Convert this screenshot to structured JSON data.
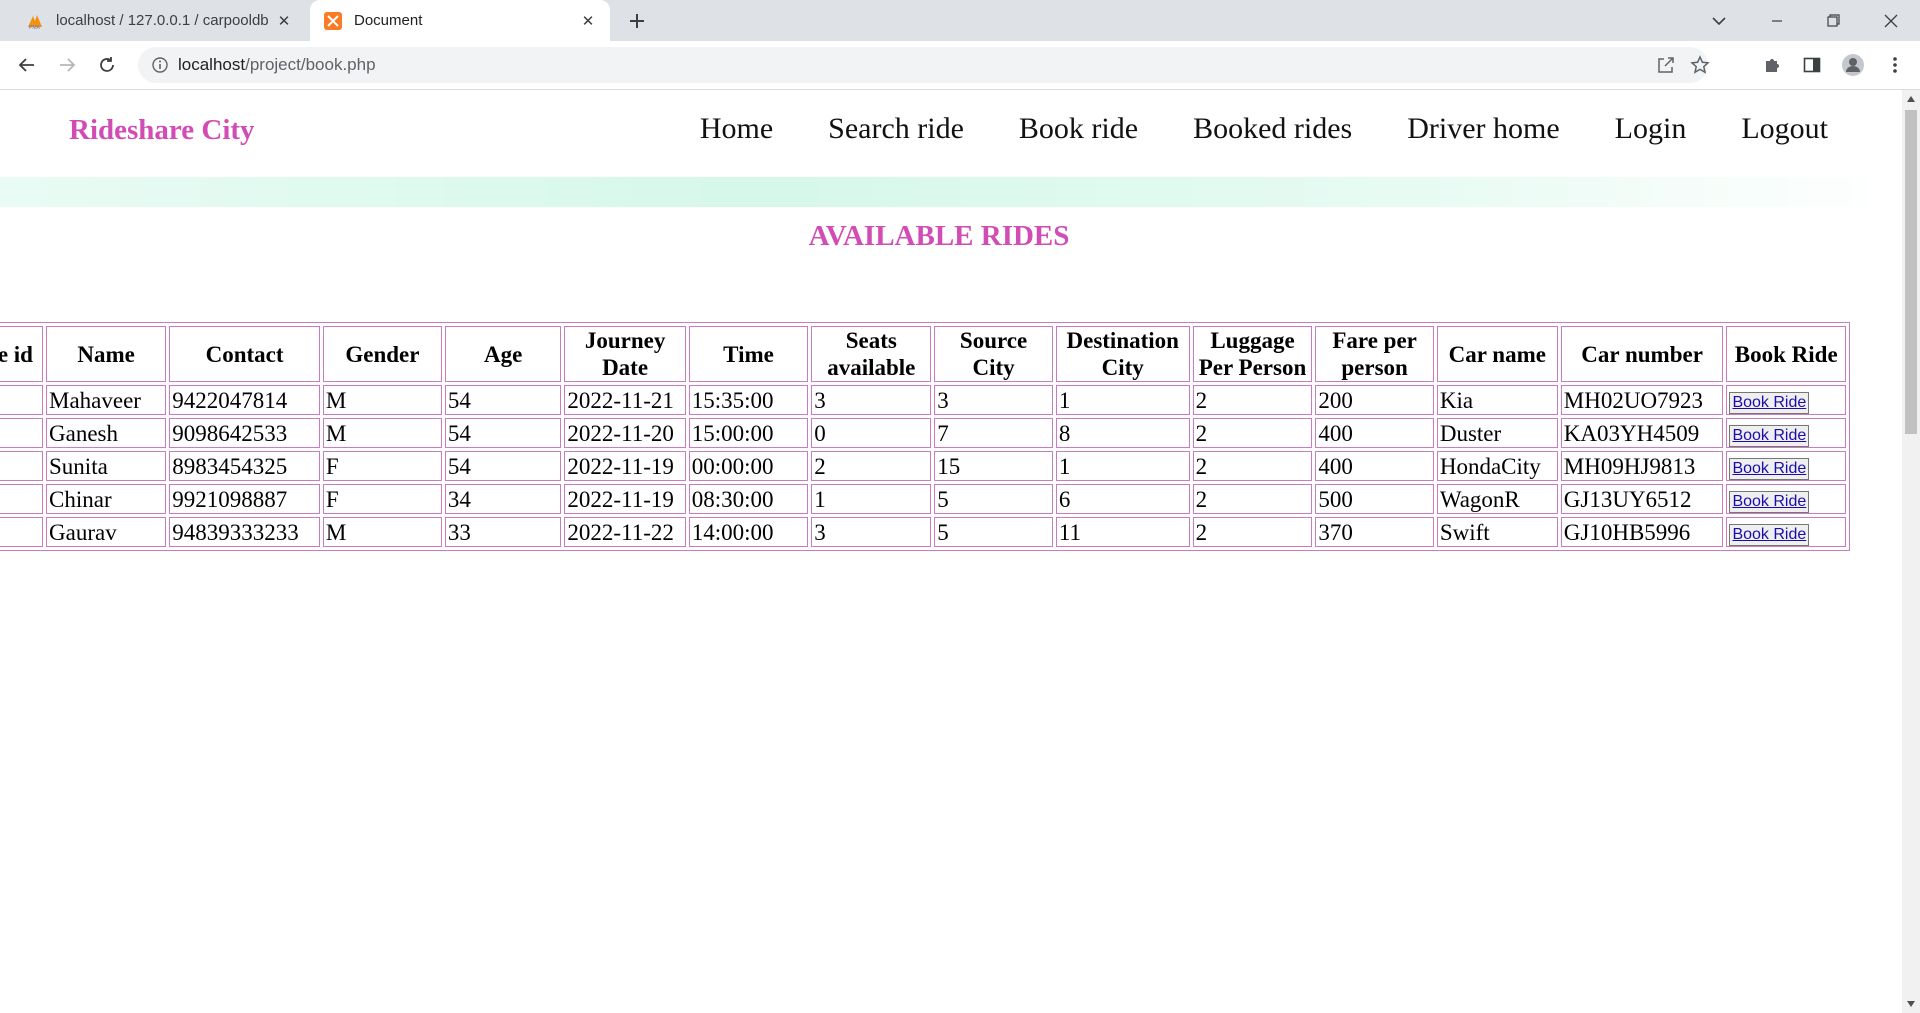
{
  "browser": {
    "tabs": [
      {
        "title": "localhost / 127.0.0.1 / carpooldb",
        "icon": "phpmyadmin-icon",
        "active": false
      },
      {
        "title": "Document",
        "icon": "xampp-icon",
        "active": true
      }
    ],
    "address": {
      "host": "localhost",
      "path": "/project/book.php"
    }
  },
  "site": {
    "brand": "Rideshare City",
    "nav": [
      "Home",
      "Search ride",
      "Book ride",
      "Booked rides",
      "Driver home",
      "Login",
      "Logout"
    ],
    "heading": "AVAILABLE RIDES",
    "accent_color": "#d14cb4"
  },
  "table": {
    "headers": [
      "Ride id",
      "Name",
      "Contact",
      "Gender",
      "Age",
      "Journey Date",
      "Time",
      "Seats available",
      "Source City",
      "Destination City",
      "Luggage Per Person",
      "Fare per person",
      "Car name",
      "Car number",
      "Book Ride"
    ],
    "rows": [
      {
        "ride_id": "",
        "name": "Mahaveer",
        "contact": "9422047814",
        "gender": "M",
        "age": "54",
        "date": "2022-11-21",
        "time": "15:35:00",
        "seats": "3",
        "source": "3",
        "destination": "1",
        "luggage": "2",
        "fare": "200",
        "car_name": "Kia",
        "car_number": "MH02UO7923",
        "action": "Book Ride"
      },
      {
        "ride_id": "",
        "name": "Ganesh",
        "contact": "9098642533",
        "gender": "M",
        "age": "54",
        "date": "2022-11-20",
        "time": "15:00:00",
        "seats": "0",
        "source": "7",
        "destination": "8",
        "luggage": "2",
        "fare": "400",
        "car_name": "Duster",
        "car_number": "KA03YH4509",
        "action": "Book Ride"
      },
      {
        "ride_id": "",
        "name": "Sunita",
        "contact": "8983454325",
        "gender": "F",
        "age": "54",
        "date": "2022-11-19",
        "time": "00:00:00",
        "seats": "2",
        "source": "15",
        "destination": "1",
        "luggage": "2",
        "fare": "400",
        "car_name": "HondaCity",
        "car_number": "MH09HJ9813",
        "action": "Book Ride"
      },
      {
        "ride_id": "",
        "name": "Chinar",
        "contact": "9921098887",
        "gender": "F",
        "age": "34",
        "date": "2022-11-19",
        "time": "08:30:00",
        "seats": "1",
        "source": "5",
        "destination": "6",
        "luggage": "2",
        "fare": "500",
        "car_name": "WagonR",
        "car_number": "GJ13UY6512",
        "action": "Book Ride"
      },
      {
        "ride_id": "",
        "name": "Gaurav",
        "contact": "94839333233",
        "gender": "M",
        "age": "33",
        "date": "2022-11-22",
        "time": "14:00:00",
        "seats": "3",
        "source": "5",
        "destination": "11",
        "luggage": "2",
        "fare": "370",
        "car_name": "Swift",
        "car_number": "GJ10HB5996",
        "action": "Book Ride"
      }
    ]
  }
}
